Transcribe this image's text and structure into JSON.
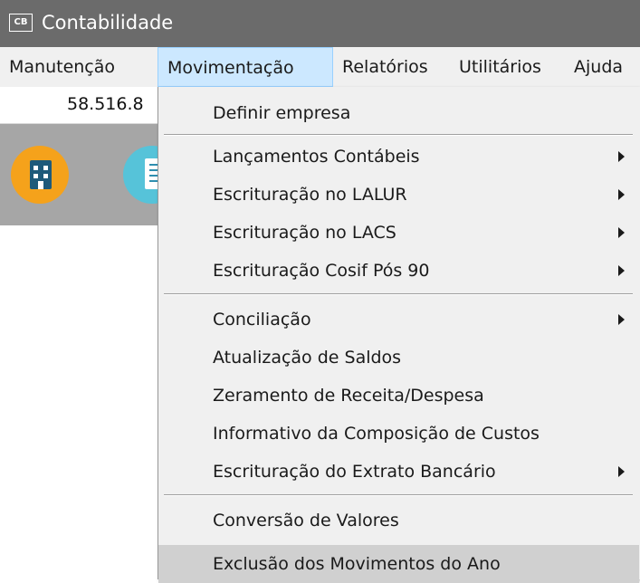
{
  "app": {
    "title": "Contabilidade",
    "icon_label": "CB",
    "icon_name": "app-logo-icon"
  },
  "menubar": {
    "items": [
      {
        "label": "Manutenção"
      },
      {
        "label": "Movimentação",
        "open": true
      },
      {
        "label": "Relatórios"
      },
      {
        "label": "Utilitários"
      },
      {
        "label": "Ajuda"
      }
    ]
  },
  "toolbar": {
    "number_text": "58.516.8",
    "icons": [
      "building-icon",
      "document-icon"
    ]
  },
  "dropdown": {
    "items": [
      {
        "label": "Definir empresa",
        "submenu": false
      },
      {
        "label": "Lançamentos Contábeis",
        "submenu": true
      },
      {
        "label": "Escrituração no LALUR",
        "submenu": true
      },
      {
        "label": "Escrituração no LACS",
        "submenu": true
      },
      {
        "label": "Escrituração Cosif Pós 90",
        "submenu": true
      },
      {
        "label": "Conciliação",
        "submenu": true
      },
      {
        "label": "Atualização de Saldos",
        "submenu": false
      },
      {
        "label": "Zeramento de Receita/Despesa",
        "submenu": false
      },
      {
        "label": "Informativo da Composição de Custos",
        "submenu": false
      },
      {
        "label": "Escrituração do Extrato Bancário",
        "submenu": true
      },
      {
        "label": "Conversão de Valores",
        "submenu": false
      },
      {
        "label": "Exclusão dos Movimentos do Ano",
        "submenu": false,
        "highlighted": true
      }
    ]
  },
  "colors": {
    "titlebar": "#6b6b6b",
    "menu_open_bg": "#cce8ff",
    "menu_bg": "#f0f0f0",
    "highlight": "#d0d0d0",
    "building_circle": "#f5a21b",
    "document_circle": "#56c3d9"
  }
}
